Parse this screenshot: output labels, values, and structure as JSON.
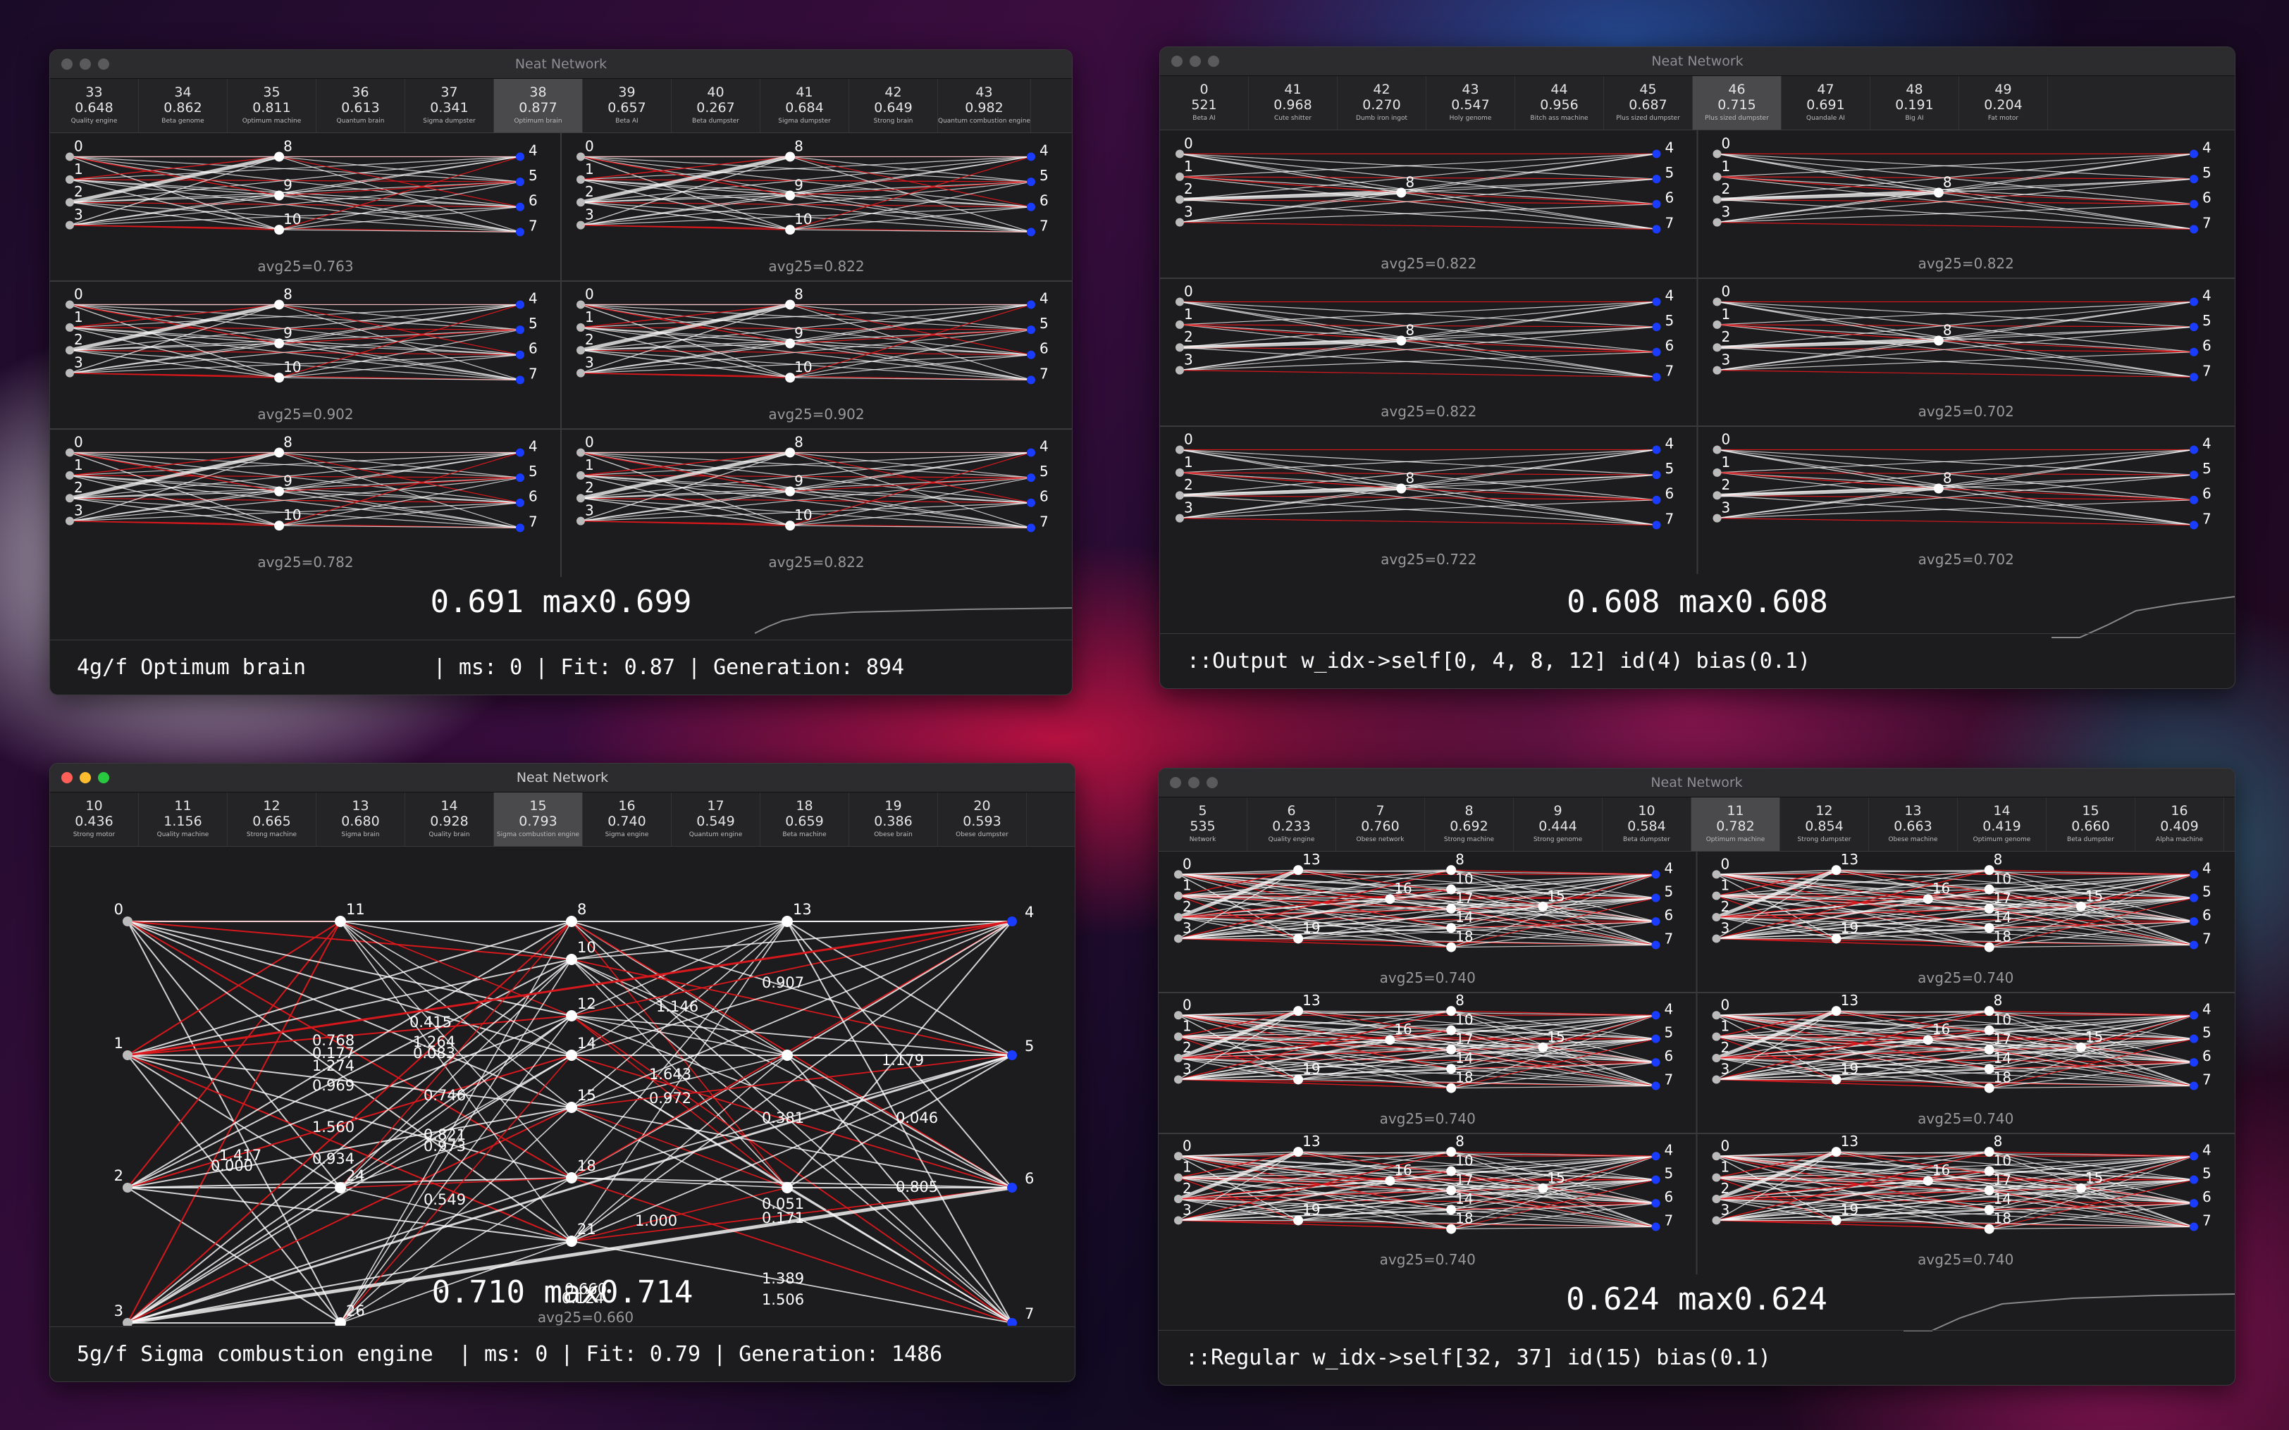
{
  "windows": [
    {
      "title": "Neat Network",
      "traffic_lights_active": false,
      "tabs": [
        {
          "id": "33",
          "value": "0.648",
          "name": "Quality engine"
        },
        {
          "id": "34",
          "value": "0.862",
          "name": "Beta genome"
        },
        {
          "id": "35",
          "value": "0.811",
          "name": "Optimum machine"
        },
        {
          "id": "36",
          "value": "0.613",
          "name": "Quantum brain"
        },
        {
          "id": "37",
          "value": "0.341",
          "name": "Sigma dumpster"
        },
        {
          "id": "38",
          "value": "0.877",
          "name": "Optimum brain",
          "active": true
        },
        {
          "id": "39",
          "value": "0.657",
          "name": "Beta AI"
        },
        {
          "id": "40",
          "value": "0.267",
          "name": "Beta dumpster"
        },
        {
          "id": "41",
          "value": "0.684",
          "name": "Sigma dumpster"
        },
        {
          "id": "42",
          "value": "0.649",
          "name": "Strong brain"
        },
        {
          "id": "43",
          "value": "0.982",
          "name": "Quantum combustion engine"
        }
      ],
      "grid_avgs": [
        "avg25=0.763",
        "avg25=0.822",
        "avg25=0.902",
        "avg25=0.902",
        "avg25=0.782",
        "avg25=0.822"
      ],
      "stats": "0.691 max0.699",
      "status": "4g/f Optimum brain          | ms: 0 | Fit: 0.87 | Generation: 894"
    },
    {
      "title": "Neat Network",
      "traffic_lights_active": false,
      "tabs": [
        {
          "id": "0",
          "value": "521",
          "name": "Beta AI"
        },
        {
          "id": "41",
          "value": "0.968",
          "name": "Cute shitter"
        },
        {
          "id": "42",
          "value": "0.270",
          "name": "Dumb iron ingot"
        },
        {
          "id": "43",
          "value": "0.547",
          "name": "Holy genome"
        },
        {
          "id": "44",
          "value": "0.956",
          "name": "Bitch ass machine"
        },
        {
          "id": "45",
          "value": "0.687",
          "name": "Plus sized dumpster"
        },
        {
          "id": "46",
          "value": "0.715",
          "name": "Plus sized dumpster",
          "active": true
        },
        {
          "id": "47",
          "value": "0.691",
          "name": "Quandale AI"
        },
        {
          "id": "48",
          "value": "0.191",
          "name": "Big AI"
        },
        {
          "id": "49",
          "value": "0.204",
          "name": "Fat motor"
        }
      ],
      "grid_avgs": [
        "avg25=0.822",
        "avg25=0.822",
        "avg25=0.822",
        "avg25=0.702",
        "avg25=0.722",
        "avg25=0.702"
      ],
      "stats": "0.608 max0.608",
      "status": "::Output w_idx->self[0, 4, 8, 12] id(4) bias(0.1)"
    },
    {
      "title": "Neat Network",
      "traffic_lights_active": true,
      "tabs": [
        {
          "id": "10",
          "value": "0.436",
          "name": "Strong motor"
        },
        {
          "id": "11",
          "value": "1.156",
          "name": "Quality machine"
        },
        {
          "id": "12",
          "value": "0.665",
          "name": "Strong machine"
        },
        {
          "id": "13",
          "value": "0.680",
          "name": "Sigma brain"
        },
        {
          "id": "14",
          "value": "0.928",
          "name": "Quality brain"
        },
        {
          "id": "15",
          "value": "0.793",
          "name": "Sigma combustion engine",
          "active": true
        },
        {
          "id": "16",
          "value": "0.740",
          "name": "Sigma engine"
        },
        {
          "id": "17",
          "value": "0.549",
          "name": "Quantum engine"
        },
        {
          "id": "18",
          "value": "0.659",
          "name": "Beta machine"
        },
        {
          "id": "19",
          "value": "0.386",
          "name": "Obese brain"
        },
        {
          "id": "20",
          "value": "0.593",
          "name": "Obese dumpster"
        }
      ],
      "big_network": {
        "inputs": [
          "0",
          "1",
          "2",
          "3"
        ],
        "hidden_a": [
          "11",
          "24",
          "26"
        ],
        "hidden_b": [
          "8",
          "10",
          "12",
          "14",
          "15",
          "18",
          "21"
        ],
        "hidden_c": [
          "13"
        ],
        "outputs": [
          "4",
          "5",
          "6",
          "7"
        ],
        "weights": [
          "1.417",
          "0.415",
          "1.264",
          "0.083",
          "0.768",
          "0.177",
          "1.274",
          "0.969",
          "1.560",
          "0.746",
          "1.146",
          "1.643",
          "0.972",
          "0.907",
          "1.179",
          "0.381",
          "0.046",
          "0.821",
          "0.973",
          "0.549",
          "0.934",
          "1.000",
          "0.051",
          "0.171",
          "1.389",
          "1.506",
          "0.000",
          "0.805",
          "0.124",
          "0.660"
        ],
        "avg": "avg25=0.660"
      },
      "stats": "0.710 max0.714",
      "status": "5g/f Sigma combustion engine  | ms: 0 | Fit: 0.79 | Generation: 1486"
    },
    {
      "title": "Neat Network",
      "traffic_lights_active": false,
      "tabs": [
        {
          "id": "5",
          "value": "535",
          "name": "Network"
        },
        {
          "id": "6",
          "value": "0.233",
          "name": "Quality engine"
        },
        {
          "id": "7",
          "value": "0.760",
          "name": "Obese network"
        },
        {
          "id": "8",
          "value": "0.692",
          "name": "Strong machine"
        },
        {
          "id": "9",
          "value": "0.444",
          "name": "Strong genome"
        },
        {
          "id": "10",
          "value": "0.584",
          "name": "Beta dumpster"
        },
        {
          "id": "11",
          "value": "0.782",
          "name": "Optimum machine",
          "active": true
        },
        {
          "id": "12",
          "value": "0.854",
          "name": "Strong dumpster"
        },
        {
          "id": "13",
          "value": "0.663",
          "name": "Obese machine"
        },
        {
          "id": "14",
          "value": "0.419",
          "name": "Optimum genome"
        },
        {
          "id": "15",
          "value": "0.660",
          "name": "Beta dumpster"
        },
        {
          "id": "16",
          "value": "0.409",
          "name": "Alpha machine"
        }
      ],
      "grid_avgs": [
        "avg25=0.740",
        "avg25=0.740",
        "avg25=0.740",
        "avg25=0.740",
        "avg25=0.740",
        "avg25=0.740"
      ],
      "stats": "0.624 max0.624",
      "status": "::Regular w_idx->self[32, 37] id(15) bias(0.1)"
    }
  ],
  "colors": {
    "window_bg": "#1c1c1e",
    "edge_positive": "#ffffff",
    "edge_negative": "#e0181c",
    "output_node": "#1a3cff"
  }
}
